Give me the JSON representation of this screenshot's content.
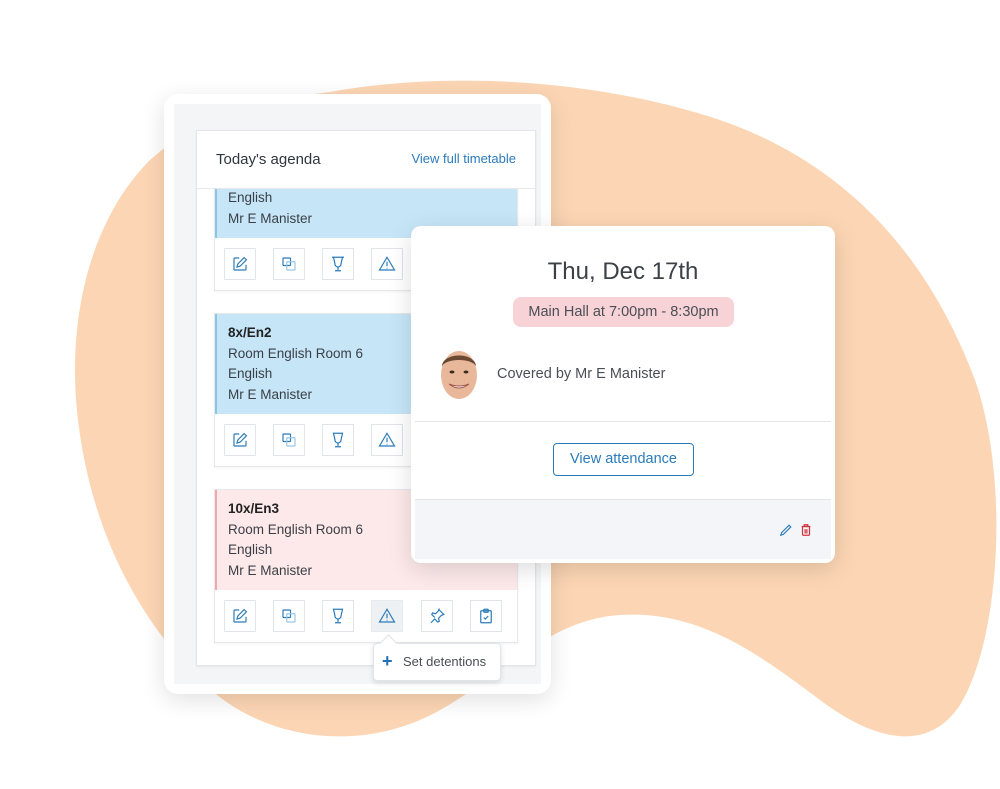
{
  "agenda": {
    "title": "Today's agenda",
    "view_link": "View full timetable",
    "lessons": [
      {
        "code": "",
        "room": "",
        "subject": "English",
        "teacher": "Mr E Manister",
        "status": "normal"
      },
      {
        "code": "8x/En2",
        "room": "Room English Room 6",
        "subject": "English",
        "teacher": "Mr E Manister",
        "status": "normal"
      },
      {
        "code": "10x/En3",
        "room": "Room English Room 6",
        "subject": "English",
        "teacher": "Mr E Manister",
        "status": "cover"
      }
    ],
    "action_icons": [
      "edit-icon",
      "copy-icon",
      "trophy-icon",
      "warning-icon",
      "pin-icon",
      "clipboard-check-icon"
    ],
    "tooltip": {
      "icon": "plus-icon",
      "label": "Set detentions"
    }
  },
  "popup": {
    "date": "Thu, Dec 17th",
    "location_time": "Main Hall at 7:00pm - 8:30pm",
    "covered_by": "Covered by Mr E Manister",
    "button_label": "View attendance",
    "footer_icons": [
      "pencil-icon",
      "trash-icon"
    ]
  },
  "colors": {
    "accent": "#2b7bb9",
    "lesson_blue": "#c6e6f8",
    "lesson_pink": "#fde9ea",
    "badge_pink": "#f7d2d6",
    "delete_red": "#d0343f",
    "blob": "#fcd6b4"
  }
}
